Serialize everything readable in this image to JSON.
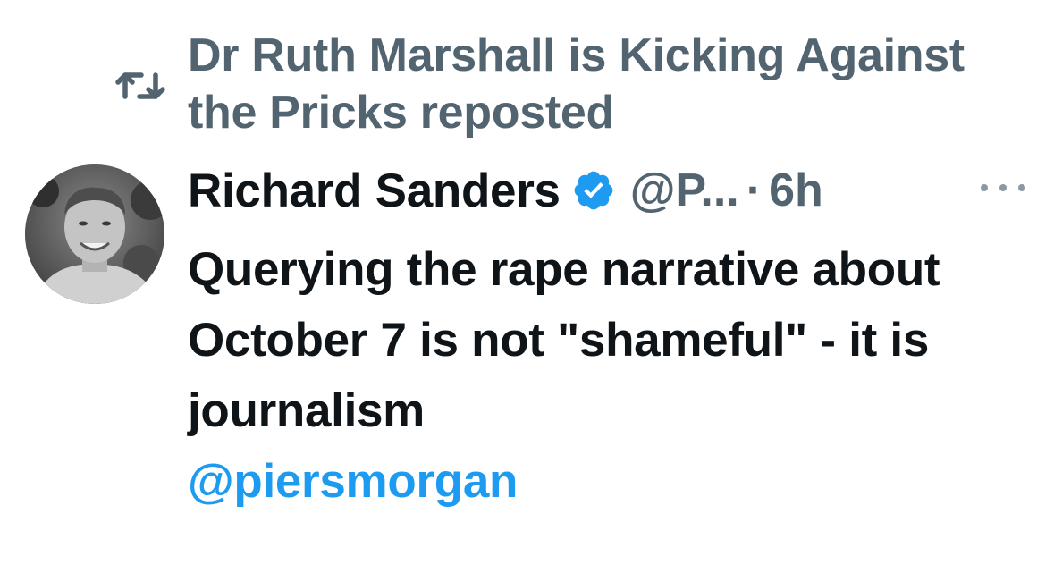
{
  "repost": {
    "icon": "repost-icon",
    "text": "Dr Ruth Marshall is Kicking Against the Pricks reposted"
  },
  "tweet": {
    "author": {
      "display_name": "Richard Sanders",
      "verified_icon": "verified-badge-icon",
      "handle": "@P...",
      "separator": "·",
      "time": "6h",
      "avatar": "avatar"
    },
    "more_icon": "more-options-icon",
    "text": "Querying the rape narrative about October 7 is not \"shameful\" - it is journalism",
    "mention": "@piersmorgan"
  },
  "colors": {
    "text_primary": "#0f1419",
    "text_secondary": "#536471",
    "link_blue": "#1d9bf0",
    "verified_blue": "#1d9bf0"
  }
}
